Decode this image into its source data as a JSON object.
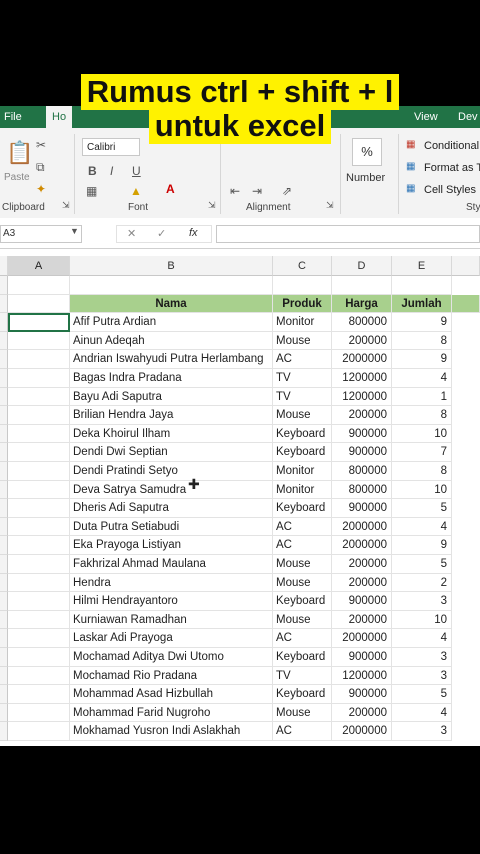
{
  "caption": {
    "line1": "Rumus ctrl + shift + l",
    "line2": "untuk excel"
  },
  "ribbon": {
    "tabs": [
      "File",
      "Ho",
      "View",
      "Dev"
    ],
    "active_tab": "Ho",
    "clipboard": {
      "paste_label": "Paste",
      "group_label": "Clipboard"
    },
    "font": {
      "font_name": "Calibri",
      "group_label": "Font",
      "bold": "B",
      "italic": "I",
      "underline": "U"
    },
    "alignment": {
      "group_label": "Alignment"
    },
    "number": {
      "percent": "%",
      "label": "Number"
    },
    "styles": {
      "items": [
        "Conditional",
        "Format as T",
        "Cell Styles"
      ],
      "group_label": "Sty"
    }
  },
  "formula_bar": {
    "name_box": "A3",
    "fx": "fx"
  },
  "sheet": {
    "columns": [
      "A",
      "B",
      "C",
      "D",
      "E"
    ],
    "selected_column": "A",
    "header_row": {
      "nama": "Nama",
      "produk": "Produk",
      "harga": "Harga",
      "jumlah": "Jumlah"
    },
    "rows": [
      {
        "nama": "Afif Putra Ardian",
        "produk": "Monitor",
        "harga": "800000",
        "jumlah": "9"
      },
      {
        "nama": "Ainun Adeqah",
        "produk": "Mouse",
        "harga": "200000",
        "jumlah": "8"
      },
      {
        "nama": "Andrian Iswahyudi Putra Herlambang",
        "produk": "AC",
        "harga": "2000000",
        "jumlah": "9"
      },
      {
        "nama": "Bagas Indra Pradana",
        "produk": "TV",
        "harga": "1200000",
        "jumlah": "4"
      },
      {
        "nama": "Bayu Adi Saputra",
        "produk": "TV",
        "harga": "1200000",
        "jumlah": "1"
      },
      {
        "nama": "Brilian Hendra Jaya",
        "produk": "Mouse",
        "harga": "200000",
        "jumlah": "8"
      },
      {
        "nama": "Deka Khoirul Ilham",
        "produk": "Keyboard",
        "harga": "900000",
        "jumlah": "10"
      },
      {
        "nama": "Dendi Dwi Septian",
        "produk": "Keyboard",
        "harga": "900000",
        "jumlah": "7"
      },
      {
        "nama": "Dendi Pratindi Setyo",
        "produk": "Monitor",
        "harga": "800000",
        "jumlah": "8"
      },
      {
        "nama": "Deva Satrya Samudra",
        "produk": "Monitor",
        "harga": "800000",
        "jumlah": "10"
      },
      {
        "nama": "Dheris Adi Saputra",
        "produk": "Keyboard",
        "harga": "900000",
        "jumlah": "5"
      },
      {
        "nama": "Duta Putra Setiabudi",
        "produk": "AC",
        "harga": "2000000",
        "jumlah": "4"
      },
      {
        "nama": "Eka Prayoga Listiyan",
        "produk": "AC",
        "harga": "2000000",
        "jumlah": "9"
      },
      {
        "nama": "Fakhrizal Ahmad Maulana",
        "produk": "Mouse",
        "harga": "200000",
        "jumlah": "5"
      },
      {
        "nama": "Hendra",
        "produk": "Mouse",
        "harga": "200000",
        "jumlah": "2"
      },
      {
        "nama": "Hilmi Hendrayantoro",
        "produk": "Keyboard",
        "harga": "900000",
        "jumlah": "3"
      },
      {
        "nama": "Kurniawan Ramadhan",
        "produk": "Mouse",
        "harga": "200000",
        "jumlah": "10"
      },
      {
        "nama": "Laskar Adi Prayoga",
        "produk": "AC",
        "harga": "2000000",
        "jumlah": "4"
      },
      {
        "nama": "Mochamad Aditya Dwi Utomo",
        "produk": "Keyboard",
        "harga": "900000",
        "jumlah": "3"
      },
      {
        "nama": "Mochamad Rio Pradana",
        "produk": "TV",
        "harga": "1200000",
        "jumlah": "3"
      },
      {
        "nama": "Mohammad Asad Hizbullah",
        "produk": "Keyboard",
        "harga": "900000",
        "jumlah": "5"
      },
      {
        "nama": "Mohammad Farid Nugroho",
        "produk": "Mouse",
        "harga": "200000",
        "jumlah": "4"
      },
      {
        "nama": "Mokhamad Yusron Indi Aslakhah",
        "produk": "AC",
        "harga": "2000000",
        "jumlah": "3"
      }
    ]
  },
  "colors": {
    "excel_green": "#217346",
    "header_fill": "#a8d08d",
    "caption_bg": "#fff200"
  }
}
